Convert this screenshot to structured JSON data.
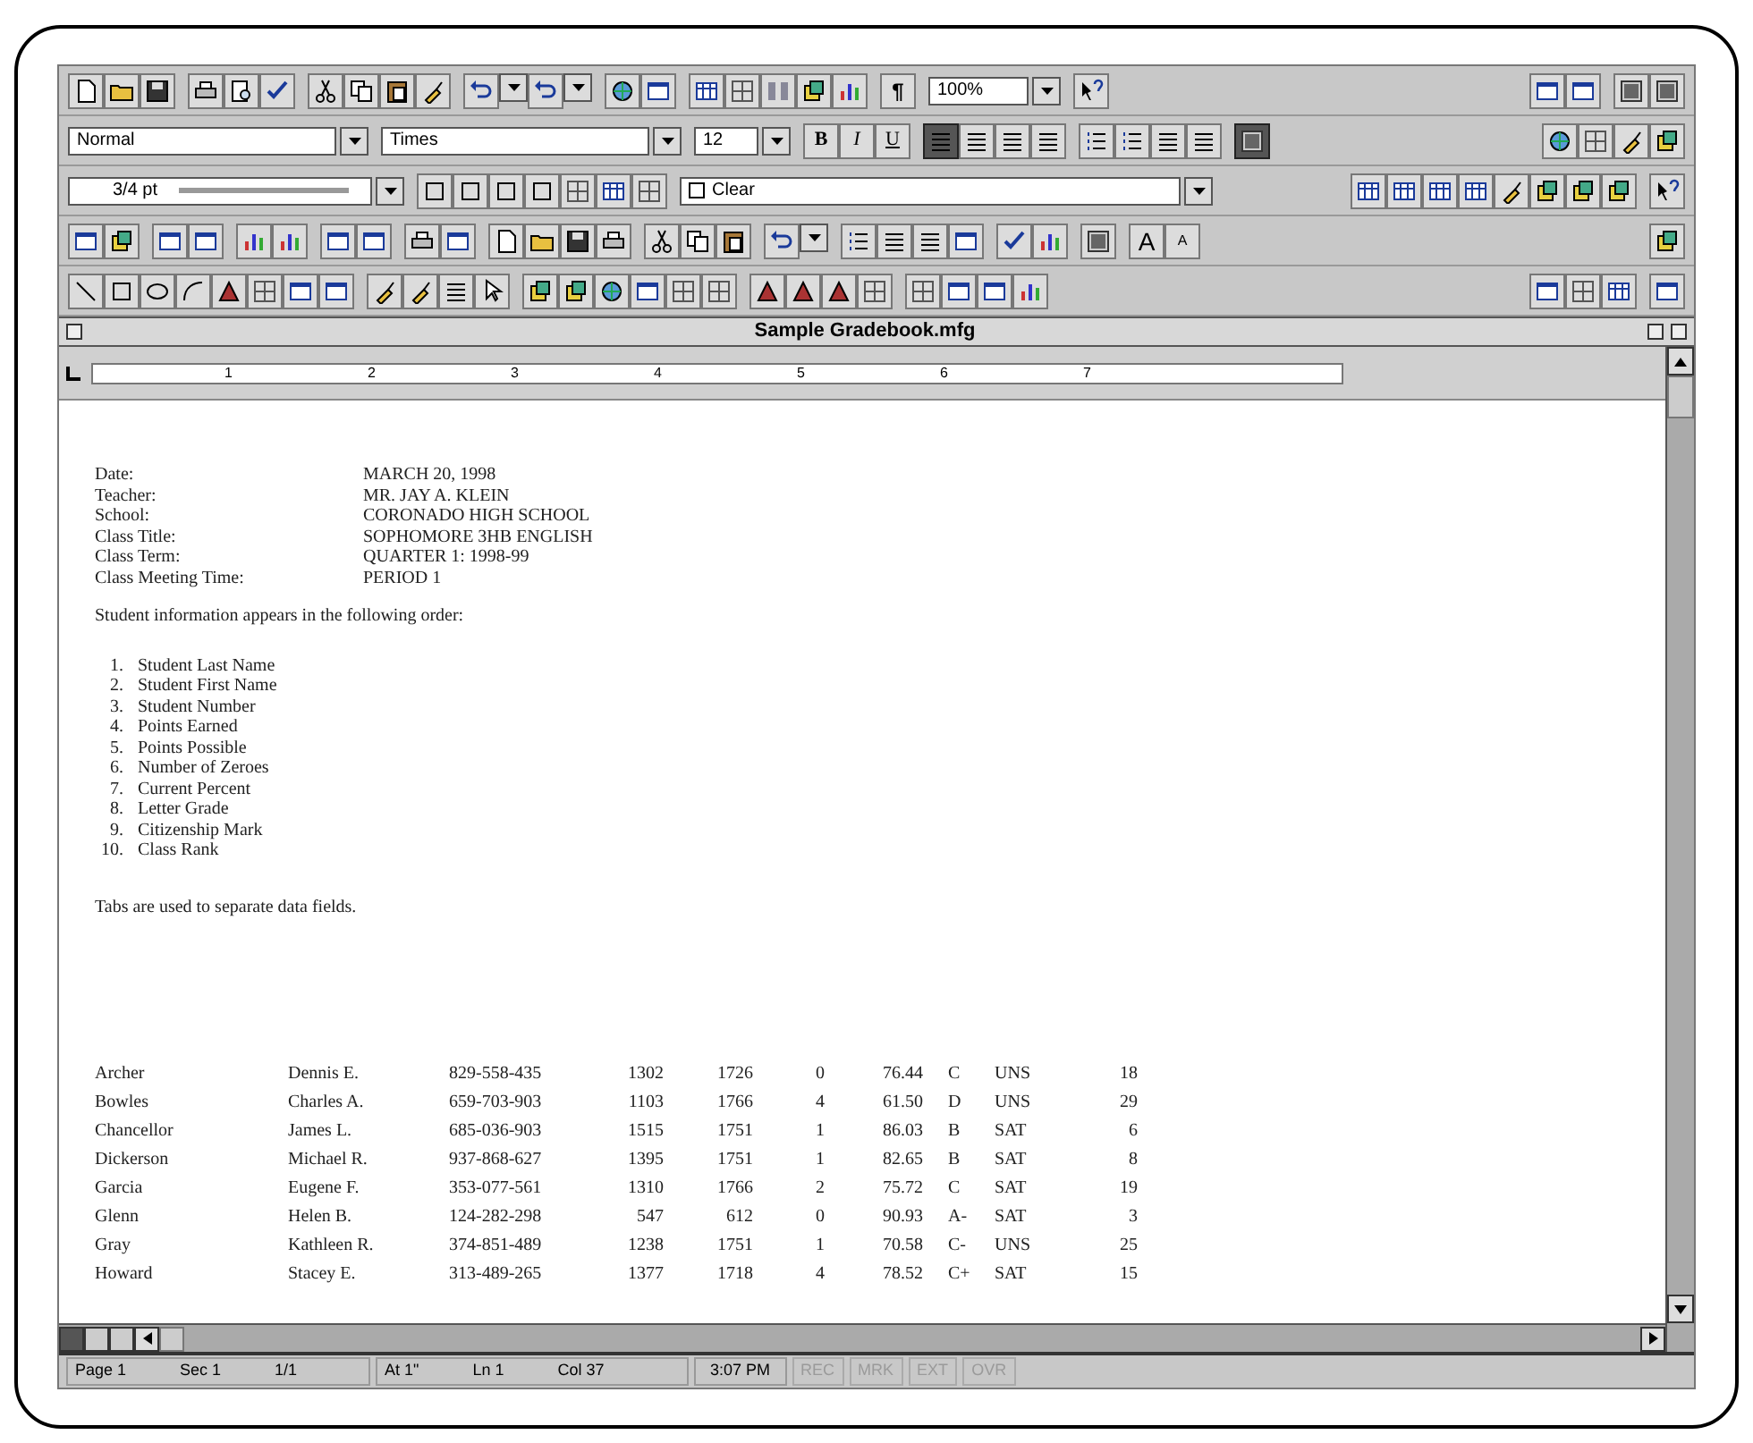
{
  "toolbars": {
    "zoom": "100%",
    "pilcrow": "¶",
    "style": "Normal",
    "font": "Times",
    "size": "12",
    "format_buttons": [
      "B",
      "I",
      "U"
    ],
    "align_buttons": [
      {
        "selected": true
      },
      {
        "selected": false
      },
      {
        "selected": false
      },
      {
        "selected": false
      }
    ],
    "borders_pressed": true,
    "line_weight": "3/4 pt",
    "shading": "Clear",
    "font_size_buttons": [
      "A",
      "A"
    ]
  },
  "window": {
    "title": "Sample Gradebook.mfg"
  },
  "ruler": {
    "marks": [
      "1",
      "2",
      "3",
      "4",
      "5",
      "6",
      "7"
    ]
  },
  "document": {
    "header": [
      {
        "label": "Date:",
        "value": "MARCH 20, 1998"
      },
      {
        "label": "Teacher:",
        "value": "MR. JAY A. KLEIN"
      },
      {
        "label": "School:",
        "value": "CORONADO HIGH SCHOOL"
      },
      {
        "label": "Class Title:",
        "value": "SOPHOMORE 3HB ENGLISH"
      },
      {
        "label": "Class Term:",
        "value": "QUARTER 1: 1998-99"
      },
      {
        "label": "Class Meeting Time:",
        "value": "PERIOD 1"
      }
    ],
    "intro": "Student information appears in the following order:",
    "order": [
      {
        "number": "1.",
        "text": "Student Last Name"
      },
      {
        "number": "2.",
        "text": "Student First Name"
      },
      {
        "number": "3.",
        "text": "Student Number"
      },
      {
        "number": "4.",
        "text": "Points Earned"
      },
      {
        "number": "5.",
        "text": "Points Possible"
      },
      {
        "number": "6.",
        "text": "Number of Zeroes"
      },
      {
        "number": "7.",
        "text": "Current Percent"
      },
      {
        "number": "8.",
        "text": "Letter Grade"
      },
      {
        "number": "9.",
        "text": "Citizenship Mark"
      },
      {
        "number": "10.",
        "text": "Class Rank"
      }
    ],
    "note": "Tabs are used to separate data fields.",
    "rows": [
      [
        "Archer",
        "Dennis E.",
        "829-558-435",
        "1302",
        "1726",
        "0",
        "76.44",
        "C",
        "UNS",
        "18"
      ],
      [
        "Bowles",
        "Charles A.",
        "659-703-903",
        "1103",
        "1766",
        "4",
        "61.50",
        "D",
        "UNS",
        "29"
      ],
      [
        "Chancellor",
        "James L.",
        "685-036-903",
        "1515",
        "1751",
        "1",
        "86.03",
        "B",
        "SAT",
        "6"
      ],
      [
        "Dickerson",
        "Michael R.",
        "937-868-627",
        "1395",
        "1751",
        "1",
        "82.65",
        "B",
        "SAT",
        "8"
      ],
      [
        "Garcia",
        "Eugene F.",
        "353-077-561",
        "1310",
        "1766",
        "2",
        "75.72",
        "C",
        "SAT",
        "19"
      ],
      [
        "Glenn",
        "Helen B.",
        "124-282-298",
        "547",
        "612",
        "0",
        "90.93",
        "A-",
        "SAT",
        "3"
      ],
      [
        "Gray",
        "Kathleen R.",
        "374-851-489",
        "1238",
        "1751",
        "1",
        "70.58",
        "C-",
        "UNS",
        "25"
      ],
      [
        "Howard",
        "Stacey E.",
        "313-489-265",
        "1377",
        "1718",
        "4",
        "78.52",
        "C+",
        "SAT",
        "15"
      ]
    ]
  },
  "status_bar": {
    "fields": [
      {
        "text": "Page 1"
      },
      {
        "text": "Sec 1"
      },
      {
        "text": "1/1"
      },
      {
        "text": "At 1\""
      },
      {
        "text": "Ln 1"
      },
      {
        "text": "Col 37"
      },
      {
        "text": "3:07 PM"
      }
    ],
    "modes": [
      {
        "text": "REC",
        "active": false
      },
      {
        "text": "MRK",
        "active": false
      },
      {
        "text": "EXT",
        "active": false
      },
      {
        "text": "OVR",
        "active": false
      }
    ]
  }
}
